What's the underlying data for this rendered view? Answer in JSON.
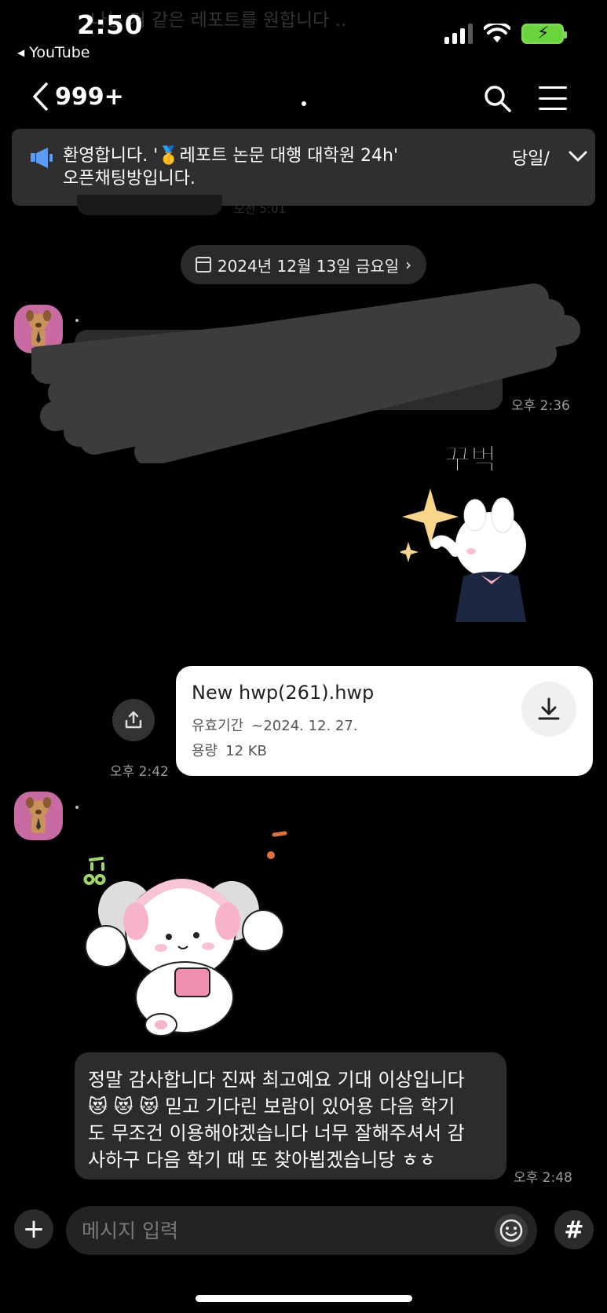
{
  "status": {
    "time": "2:50",
    "back_app": "YouTube",
    "battery_color": "#6ad43c"
  },
  "background_ghost": {
    "top_text": "나는 거 같은 레포트를 원합니다 .."
  },
  "nav": {
    "unread_count": "999+",
    "icons": [
      "chevron-left-icon",
      "search-icon",
      "menu-icon"
    ]
  },
  "notice": {
    "text": "환영합니다. '🥇레포트 논문 대행 대학원 24h' 오픈채팅방입니다.",
    "day_label": "당일/"
  },
  "date_divider": {
    "label": "2024년 12월 13일 금요일"
  },
  "messages": {
    "redacted_time": "오후 2:36",
    "sticker1_caption": "꾸벅",
    "file": {
      "name": "New hwp(261).hwp",
      "expiry_label": "유효기간",
      "expiry_value": "~2024. 12. 27.",
      "size_label": "용량",
      "size_value": "12 KB",
      "time": "오후 2:42"
    },
    "final_text": "정말 감사합니다 진짜 최고예요 기대 이상입니다\n😻 😻 😻 믿고 기다린 보람이 있어용 다음 학기\n도 무조건 이용해야겠습니다 너무 잘해주셔서 감\n사하구 다음 학기 때 또 찾아뵙겠습니당 ㅎㅎ",
    "final_time": "오후 2:48"
  },
  "input": {
    "placeholder": "메시지 입력",
    "hash_label": "#"
  },
  "colors": {
    "background": "#000000",
    "bubble": "#2c2c2c",
    "avatar_bg": "#c96ba3",
    "notice_bg": "#2f2f2f"
  }
}
